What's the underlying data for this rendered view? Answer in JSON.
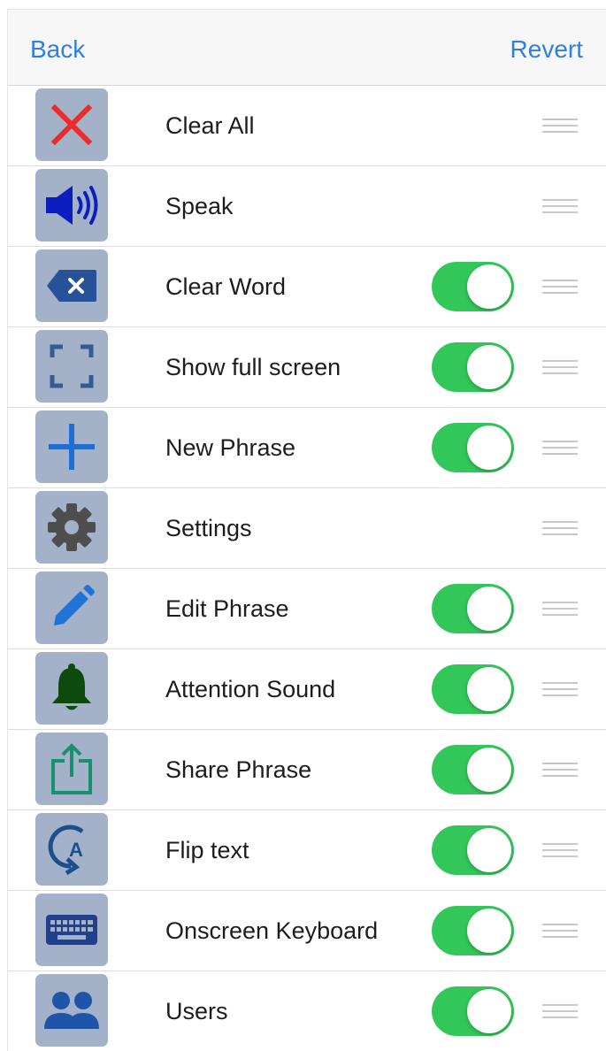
{
  "navbar": {
    "back_label": "Back",
    "revert_label": "Revert"
  },
  "colors": {
    "accent": "#2f80e2",
    "toggle_on": "#33c659",
    "tile_bg": "#a3b2c9"
  },
  "items": [
    {
      "label": "Clear All",
      "icon": "close-x-icon",
      "toggle": null
    },
    {
      "label": "Speak",
      "icon": "speaker-icon",
      "toggle": null
    },
    {
      "label": "Clear Word",
      "icon": "backspace-icon",
      "toggle": true
    },
    {
      "label": "Show full screen",
      "icon": "fullscreen-icon",
      "toggle": true
    },
    {
      "label": "New Phrase",
      "icon": "plus-icon",
      "toggle": true
    },
    {
      "label": "Settings",
      "icon": "gear-icon",
      "toggle": null
    },
    {
      "label": "Edit Phrase",
      "icon": "pencil-icon",
      "toggle": true
    },
    {
      "label": "Attention Sound",
      "icon": "bell-icon",
      "toggle": true
    },
    {
      "label": "Share Phrase",
      "icon": "share-icon",
      "toggle": true
    },
    {
      "label": "Flip text",
      "icon": "flip-text-icon",
      "toggle": true
    },
    {
      "label": "Onscreen Keyboard",
      "icon": "keyboard-icon",
      "toggle": true
    },
    {
      "label": "Users",
      "icon": "users-icon",
      "toggle": true
    }
  ]
}
